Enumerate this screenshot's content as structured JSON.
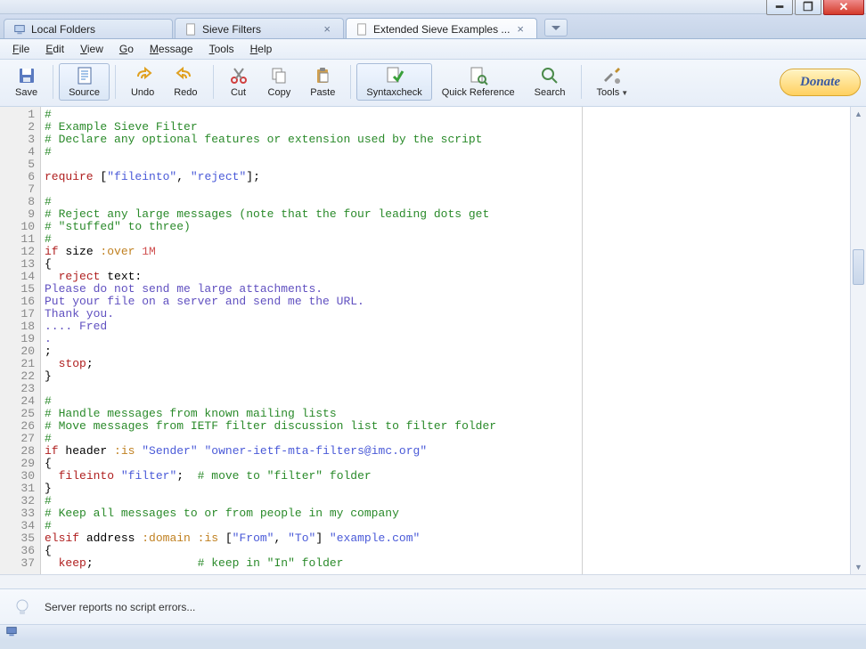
{
  "tabs": [
    {
      "label": "Local Folders",
      "closeable": false
    },
    {
      "label": "Sieve Filters",
      "closeable": true
    },
    {
      "label": "Extended Sieve Examples ...",
      "closeable": true,
      "active": true
    }
  ],
  "menubar": [
    "File",
    "Edit",
    "View",
    "Go",
    "Message",
    "Tools",
    "Help"
  ],
  "toolbar": {
    "save": "Save",
    "source": "Source",
    "undo": "Undo",
    "redo": "Redo",
    "cut": "Cut",
    "copy": "Copy",
    "paste": "Paste",
    "syntaxcheck": "Syntaxcheck",
    "quickref": "Quick Reference",
    "search": "Search",
    "tools": "Tools",
    "donate": "Donate"
  },
  "code_lines": [
    {
      "n": 1,
      "html": "<span class='tok-comment'>#</span>"
    },
    {
      "n": 2,
      "html": "<span class='tok-comment'># Example Sieve Filter</span>"
    },
    {
      "n": 3,
      "html": "<span class='tok-comment'># Declare any optional features or extension used by the script</span>"
    },
    {
      "n": 4,
      "html": "<span class='tok-comment'>#</span>"
    },
    {
      "n": 5,
      "html": ""
    },
    {
      "n": 6,
      "html": "<span class='tok-keyword'>require</span> [<span class='tok-string'>\"fileinto\"</span>, <span class='tok-string'>\"reject\"</span>];"
    },
    {
      "n": 7,
      "html": ""
    },
    {
      "n": 8,
      "html": "<span class='tok-comment'>#</span>"
    },
    {
      "n": 9,
      "html": "<span class='tok-comment'># Reject any large messages (note that the four leading dots get</span>"
    },
    {
      "n": 10,
      "html": "<span class='tok-comment'># \"stuffed\" to three)</span>"
    },
    {
      "n": 11,
      "html": "<span class='tok-comment'>#</span>"
    },
    {
      "n": 12,
      "html": "<span class='tok-keyword'>if</span> size <span class='tok-tagged'>:over</span> <span class='tok-number'>1M</span>"
    },
    {
      "n": 13,
      "html": "{"
    },
    {
      "n": 14,
      "html": "  <span class='tok-keyword'>reject</span> text:"
    },
    {
      "n": 15,
      "html": "<span class='tok-text'>Please do not send me large attachments.</span>"
    },
    {
      "n": 16,
      "html": "<span class='tok-text'>Put your file on a server and send me the URL.</span>"
    },
    {
      "n": 17,
      "html": "<span class='tok-text'>Thank you.</span>"
    },
    {
      "n": 18,
      "html": "<span class='tok-text'>.... Fred</span>"
    },
    {
      "n": 19,
      "html": "<span class='tok-text'>.</span>"
    },
    {
      "n": 20,
      "html": ";"
    },
    {
      "n": 21,
      "html": "  <span class='tok-keyword'>stop</span>;"
    },
    {
      "n": 22,
      "html": "}"
    },
    {
      "n": 23,
      "html": ""
    },
    {
      "n": 24,
      "html": "<span class='tok-comment'>#</span>"
    },
    {
      "n": 25,
      "html": "<span class='tok-comment'># Handle messages from known mailing lists</span>"
    },
    {
      "n": 26,
      "html": "<span class='tok-comment'># Move messages from IETF filter discussion list to filter folder</span>"
    },
    {
      "n": 27,
      "html": "<span class='tok-comment'>#</span>"
    },
    {
      "n": 28,
      "html": "<span class='tok-keyword'>if</span> header <span class='tok-tagged'>:is</span> <span class='tok-string'>\"Sender\"</span> <span class='tok-string'>\"owner-ietf-mta-filters@imc.org\"</span>"
    },
    {
      "n": 29,
      "html": "{"
    },
    {
      "n": 30,
      "html": "  <span class='tok-keyword'>fileinto</span> <span class='tok-string'>\"filter\"</span>;  <span class='tok-comment'># move to \"filter\" folder</span>"
    },
    {
      "n": 31,
      "html": "}"
    },
    {
      "n": 32,
      "html": "<span class='tok-comment'>#</span>"
    },
    {
      "n": 33,
      "html": "<span class='tok-comment'># Keep all messages to or from people in my company</span>"
    },
    {
      "n": 34,
      "html": "<span class='tok-comment'>#</span>"
    },
    {
      "n": 35,
      "html": "<span class='tok-keyword'>elsif</span> address <span class='tok-tagged'>:domain</span> <span class='tok-tagged'>:is</span> [<span class='tok-string'>\"From\"</span>, <span class='tok-string'>\"To\"</span>] <span class='tok-string'>\"example.com\"</span>"
    },
    {
      "n": 36,
      "html": "{"
    },
    {
      "n": 37,
      "html": "  <span class='tok-keyword'>keep</span>;               <span class='tok-comment'># keep in \"In\" folder</span>"
    }
  ],
  "status": "Server reports no script errors..."
}
